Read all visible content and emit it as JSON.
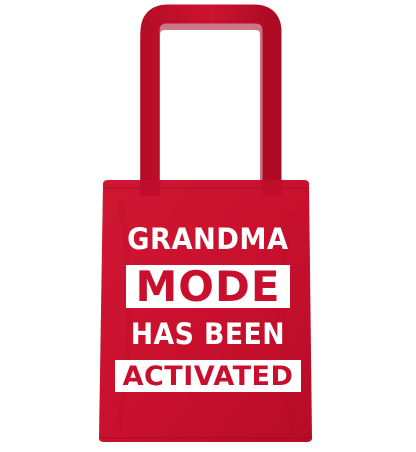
{
  "product": {
    "type": "tote bag",
    "bag_color": "#c8102e",
    "print_color": "#ffffff"
  },
  "print": {
    "line1": "GRANDMA",
    "line2": "MODE",
    "line3": "HAS BEEN",
    "line4": "ACTIVATED"
  }
}
